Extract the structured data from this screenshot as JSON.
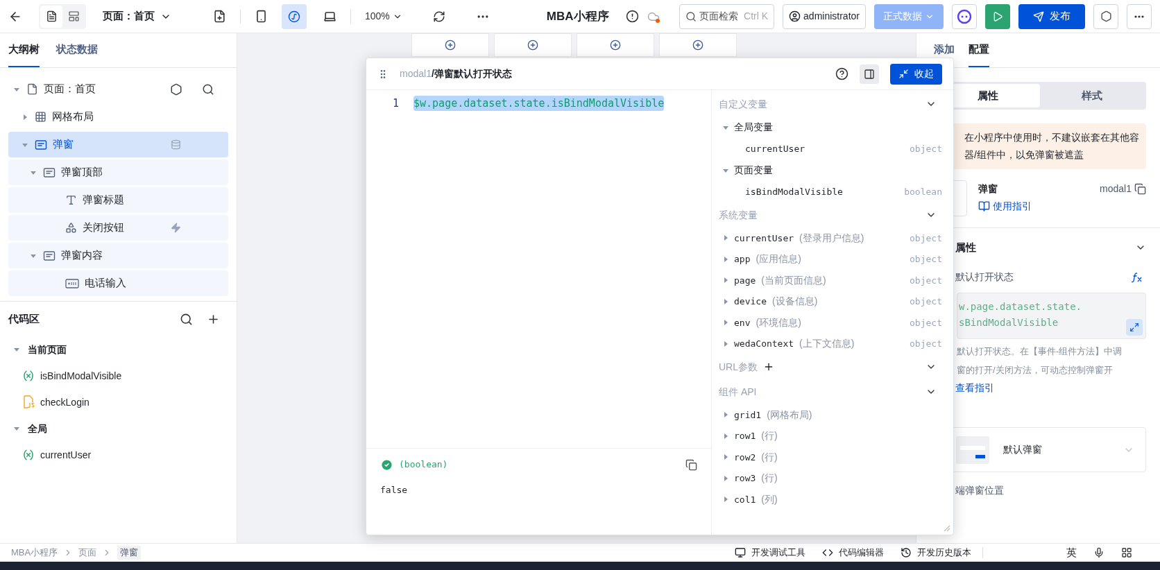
{
  "topbar": {
    "page_selector": "页面：首页",
    "zoom": "100%",
    "app_title": "MBA小程序",
    "search": {
      "placeholder": "页面检索",
      "shortcut": "Ctrl K"
    },
    "user": "administrator",
    "data_env": "正式数据",
    "publish": "发布"
  },
  "left_tabs": [
    {
      "label": "大纲树",
      "selected": true
    },
    {
      "label": "状态数据",
      "selected": false
    }
  ],
  "outline": [
    {
      "label": "页面：首页",
      "kind": "page",
      "expanded": true,
      "selected": false,
      "children": [
        {
          "label": "网格布局",
          "kind": "grid",
          "expanded": false,
          "selected": false
        },
        {
          "label": "弹窗",
          "kind": "modal",
          "expanded": true,
          "selected": true,
          "data_bound": true,
          "children": [
            {
              "label": "弹窗顶部",
              "kind": "modal",
              "expanded": true,
              "selected": false,
              "children": [
                {
                  "label": "弹窗标题",
                  "kind": "text",
                  "selected": false
                },
                {
                  "label": "关闭按钮",
                  "kind": "button",
                  "selected": false,
                  "has_event": true
                }
              ]
            },
            {
              "label": "弹窗内容",
              "kind": "modal",
              "expanded": true,
              "selected": false,
              "children": [
                {
                  "label": "电话输入",
                  "kind": "phone",
                  "selected": false
                }
              ]
            }
          ]
        }
      ]
    }
  ],
  "code_area": {
    "title": "代码区",
    "groups": [
      {
        "label": "当前页面",
        "expanded": true,
        "items": [
          {
            "name": "isBindModalVisible",
            "kind": "variable"
          },
          {
            "name": "checkLogin",
            "kind": "js"
          }
        ]
      },
      {
        "label": "全局",
        "expanded": true,
        "items": [
          {
            "name": "currentUser",
            "kind": "variable"
          }
        ]
      }
    ]
  },
  "editor": {
    "owner": "modal1",
    "title": "/弹窗默认打开状态",
    "collapse": "收起",
    "lines": [
      {
        "number": "1",
        "code": "$w.page.dataset.state.isBindModalVisible",
        "selected": true
      }
    ],
    "result": {
      "type": "(boolean)",
      "valid": true,
      "value": "false"
    },
    "sections": [
      {
        "title": "自定义变量",
        "expanded": true,
        "items": [
          {
            "name": "全局变量",
            "kind": "group",
            "expanded": true,
            "children": [
              {
                "name": "currentUser",
                "type": "object"
              }
            ]
          },
          {
            "name": "页面变量",
            "kind": "group",
            "expanded": true,
            "children": [
              {
                "name": "isBindModalVisible",
                "type": "boolean"
              }
            ]
          }
        ]
      },
      {
        "title": "系统变量",
        "expanded": true,
        "items": [
          {
            "name": "currentUser",
            "desc": "(登录用户信息)",
            "type": "object",
            "kind": "var",
            "expanded": false
          },
          {
            "name": "app",
            "desc": "(应用信息)",
            "type": "object",
            "kind": "var",
            "expanded": false
          },
          {
            "name": "page",
            "desc": "(当前页面信息)",
            "type": "object",
            "kind": "var",
            "expanded": false
          },
          {
            "name": "device",
            "desc": "(设备信息)",
            "type": "object",
            "kind": "var",
            "expanded": false
          },
          {
            "name": "env",
            "desc": "(环境信息)",
            "type": "object",
            "kind": "var",
            "expanded": false
          },
          {
            "name": "wedaContext",
            "desc": "(上下文信息)",
            "type": "object",
            "kind": "var",
            "expanded": false
          }
        ]
      },
      {
        "title": "URL参数",
        "addable": true,
        "expanded": true
      },
      {
        "title": "组件 API",
        "expanded": true,
        "items": [
          {
            "name": "grid1",
            "desc": "(网格布局)",
            "kind": "var",
            "expanded": false
          },
          {
            "name": "row1",
            "desc": "(行)",
            "kind": "var",
            "expanded": false
          },
          {
            "name": "row2",
            "desc": "(行)",
            "kind": "var",
            "expanded": false
          },
          {
            "name": "row3",
            "desc": "(行)",
            "kind": "var",
            "expanded": false
          },
          {
            "name": "col1",
            "desc": "(列)",
            "kind": "var",
            "expanded": false
          }
        ]
      }
    ]
  },
  "right_panel": {
    "tabs": [
      {
        "label": "添加",
        "selected": false
      },
      {
        "label": "配置",
        "selected": true
      }
    ],
    "segments": [
      {
        "label": "属性",
        "selected": true
      },
      {
        "label": "样式",
        "selected": false
      }
    ],
    "warning": "在小程序中使用时，不建议嵌套在其他容器/组件中，以免弹窗被遮盖",
    "component": {
      "name": "弹窗",
      "id": "modal1",
      "guide": "使用指引"
    },
    "section": {
      "title": "属性",
      "expanded": true
    },
    "field": {
      "label": "默认打开状态",
      "value_lines": [
        "w.page.dataset.state.",
        "sBindModalVisible"
      ],
      "description_lines": [
        "默认打开状态。在【事件-组件方法】中调",
        "窗的打开/关闭方法，可动态控制弹窗开"
      ],
      "link": "查看指引"
    },
    "template": "默认弹窗",
    "position_label": "端弹窗位置"
  },
  "bottom": {
    "breadcrumb": [
      "MBA小程序",
      "页面",
      "弹窗"
    ],
    "tools": [
      {
        "label": "开发调试工具",
        "kind": "debug"
      },
      {
        "label": "代码编辑器",
        "kind": "code"
      },
      {
        "label": "开发历史版本",
        "kind": "history"
      }
    ],
    "ime": "英"
  }
}
